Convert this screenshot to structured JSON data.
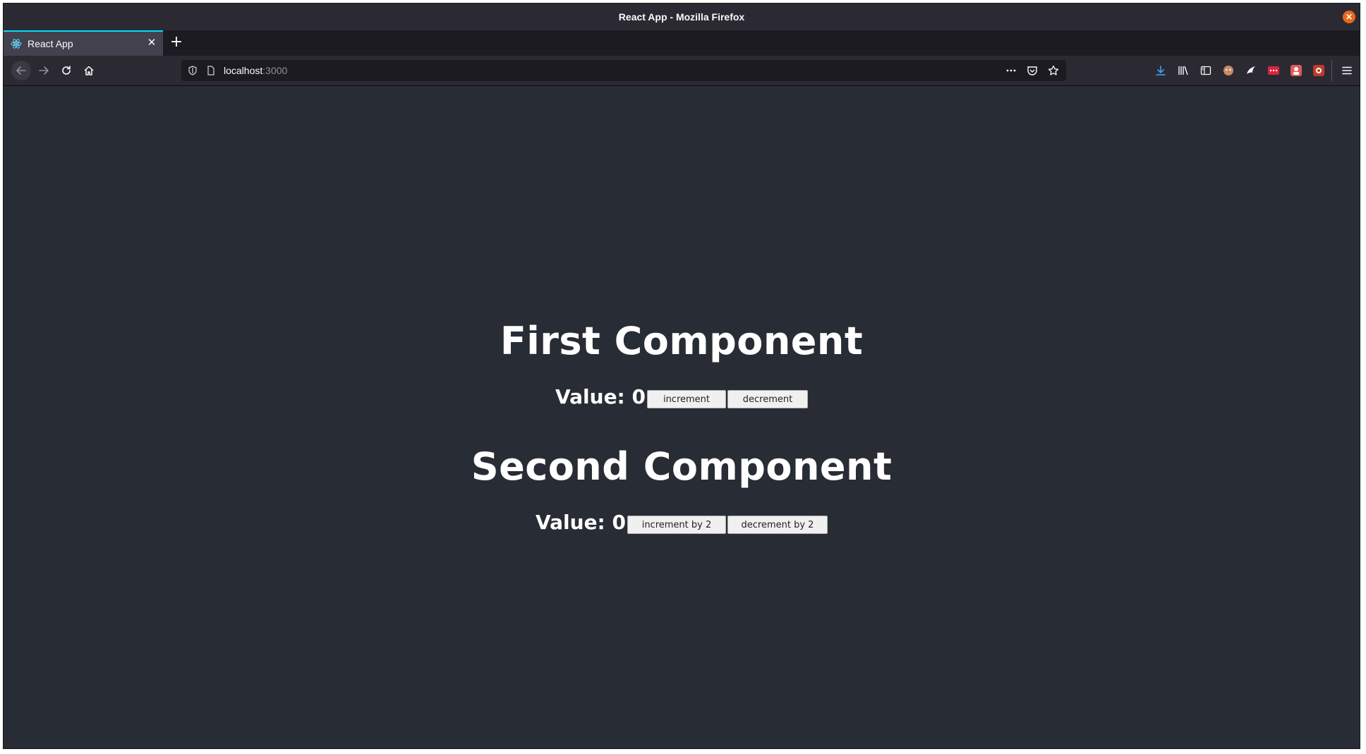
{
  "window": {
    "title": "React App - Mozilla Firefox"
  },
  "tab": {
    "label": "React App"
  },
  "urlbar": {
    "host": "localhost",
    "port": ":3000"
  },
  "first_component": {
    "heading": "First Component",
    "value_label": "Value: 0",
    "increment_label": "increment",
    "decrement_label": "decrement"
  },
  "second_component": {
    "heading": "Second Component",
    "value_label": "Value: 0",
    "increment_label": "increment by 2",
    "decrement_label": "decrement by 2"
  },
  "colors": {
    "content_bg": "#282c34",
    "chrome_bg": "#2b2a33",
    "tab_accent": "#00ddff",
    "close_button": "#e8681a"
  },
  "icons": [
    "react-favicon-icon",
    "tab-close-icon",
    "new-tab-icon",
    "back-icon",
    "forward-icon",
    "reload-icon",
    "home-icon",
    "shield-icon",
    "page-icon",
    "more-icon",
    "pocket-icon",
    "bookmark-star-icon",
    "download-icon",
    "library-icon",
    "sidebar-icon",
    "extension-icon",
    "menu-icon",
    "window-close-icon"
  ]
}
